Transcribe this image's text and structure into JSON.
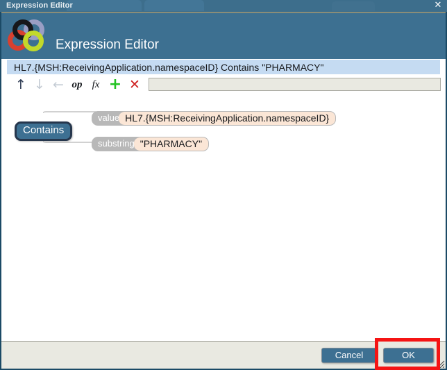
{
  "window": {
    "title": "Expression Editor",
    "close_label": "✕"
  },
  "header": {
    "title": "Expression Editor",
    "logo_name": "four-rings-logo",
    "bg_color": "#3d7091",
    "ring_colors": [
      "#17171a",
      "#9a9ec4",
      "#d8402f",
      "#c2d92b"
    ]
  },
  "expression_bar": {
    "text": "HL7.{MSH:ReceivingApplication.namespaceID} Contains \"PHARMACY\"",
    "bg_color": "#c5dbf2"
  },
  "toolbar": {
    "buttons": [
      {
        "name": "move-up-button",
        "glyph": "↑",
        "enabled": true,
        "color": "#2d3a52"
      },
      {
        "name": "move-down-button",
        "glyph": "↓",
        "enabled": false,
        "color": "#c4cbd4"
      },
      {
        "name": "move-left-button",
        "glyph": "←",
        "enabled": false,
        "color": "#c4cbd4"
      },
      {
        "name": "operator-button",
        "glyph": "op",
        "enabled": true,
        "color": "#15181c"
      },
      {
        "name": "function-button",
        "glyph": "fx",
        "enabled": true,
        "color": "#15181c"
      },
      {
        "name": "add-button",
        "glyph": "+",
        "enabled": true,
        "color": "#22c322"
      },
      {
        "name": "delete-button",
        "glyph": "✕",
        "enabled": true,
        "color": "#cf2222"
      }
    ],
    "input_value": "",
    "input_placeholder": ""
  },
  "expression_tree": {
    "operator": "Contains",
    "operator_colors": {
      "fill": "#3d7092",
      "border": "#26374d",
      "text": "#ffffff"
    },
    "params": [
      {
        "label": "value",
        "value": "HL7.{MSH:ReceivingApplication.namespaceID}"
      },
      {
        "label": "substring",
        "value": "\"PHARMACY\""
      }
    ],
    "chip_colors": {
      "fill": "#fbe6d6",
      "border": "#b9b9b9",
      "label_fill": "#b8b8b8"
    }
  },
  "footer": {
    "cancel_label": "Cancel",
    "ok_label": "OK",
    "button_color": "#3d7092",
    "bg_color": "#e9e9e1"
  },
  "annotation": {
    "highlight_color": "#f51414",
    "target": "ok-button"
  }
}
